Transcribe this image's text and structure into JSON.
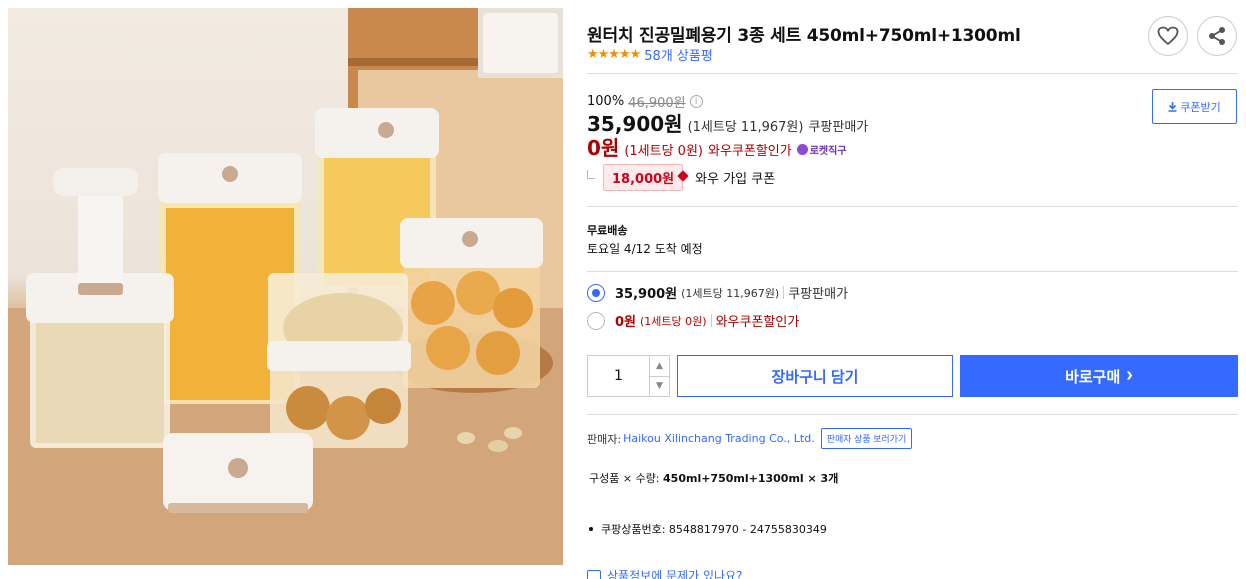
{
  "product": {
    "title": "원터치 진공밀폐용기 3종 세트 450ml+750ml+1300ml",
    "rating_stars": "★★★★★",
    "review_count": "58개 상품평",
    "rating_value": 4.5
  },
  "pricing": {
    "discount_rate": "100%",
    "original_price": "46,900원",
    "info_icon": "ⓘ",
    "sale_price": "35,900원",
    "sale_unit": "(1세트당 11,967원)",
    "sale_type": "쿠팡판매가",
    "coupon_price": "0원",
    "coupon_unit": "(1세트당 0원)",
    "coupon_type": "와우쿠폰할인가",
    "rocket_label": "로켓직구",
    "wow_amount": "18,000원",
    "wow_label": "와우 가입 쿠폰",
    "coupon_button": "쿠폰받기"
  },
  "shipping": {
    "label": "무료배송",
    "date": "토요일 4/12 도착 예정"
  },
  "options": [
    {
      "price": "35,900원",
      "unit": "(1세트당 11,967원)",
      "type": "쿠팡판매가",
      "selected": true
    },
    {
      "price": "0원",
      "unit": "(1세트당 0원)",
      "type": "와우쿠폰할인가",
      "selected": false
    }
  ],
  "purchase": {
    "quantity": "1",
    "up_glyph": "▲",
    "down_glyph": "▼",
    "cart_label": "장바구니 담기",
    "buy_label": "바로구매",
    "buy_arrow": "›"
  },
  "seller": {
    "prefix": "판매자:",
    "name": "Haikou Xilinchang Trading Co., Ltd.",
    "more_button": "판매자 상품 보러가기"
  },
  "details": {
    "composition_label": "구성품 × 수량:",
    "composition_value": "450ml+750ml+1300ml × 3개",
    "product_no": "쿠팡상품번호: 8548817970 - 24755830349",
    "report_text": "상품정보에 문제가 있나요?"
  },
  "colors": {
    "accent": "#346aff",
    "discount_red": "#ae0000",
    "wow_red": "#d0021b",
    "star": "#f58f00"
  },
  "icons": [
    "heart-icon",
    "share-icon",
    "download-icon",
    "info-icon",
    "rocket-icon",
    "chevron-right-icon",
    "report-icon"
  ]
}
